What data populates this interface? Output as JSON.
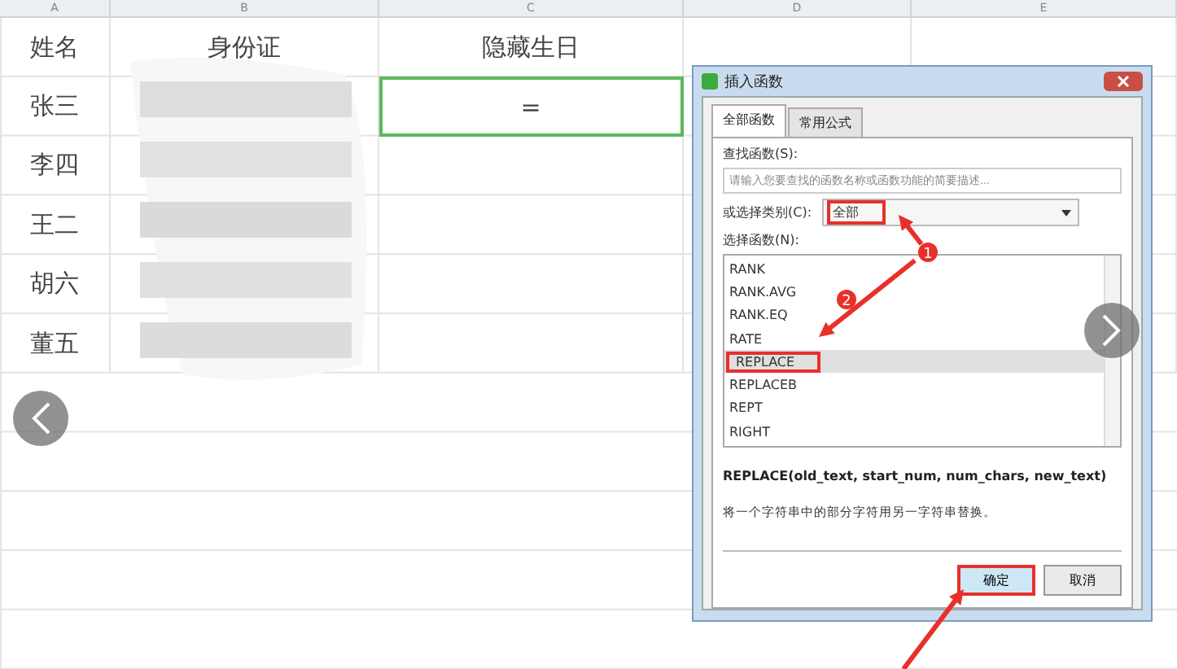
{
  "sheet": {
    "column_letters": [
      "A",
      "B",
      "C",
      "D",
      "E"
    ],
    "header": [
      "姓名",
      "身份证",
      "隐藏生日"
    ],
    "rows": [
      {
        "name": "张三",
        "formula": "=",
        "active": true
      },
      {
        "name": "李四",
        "formula": "",
        "active": false
      },
      {
        "name": "王二",
        "formula": "",
        "active": false
      },
      {
        "name": "胡六",
        "formula": "",
        "active": false
      },
      {
        "name": "董五",
        "formula": "",
        "active": false
      }
    ]
  },
  "dialog": {
    "title": "插入函数",
    "tabs": [
      {
        "label": "全部函数",
        "selected": true
      },
      {
        "label": "常用公式",
        "selected": false
      }
    ],
    "search_label": "查找函数(S):",
    "search_placeholder": "请输入您要查找的函数名称或函数功能的简要描述...",
    "category_label": "或选择类别(C):",
    "category_value": "全部",
    "list_label": "选择函数(N):",
    "functions": [
      {
        "name": "RANK",
        "selected": false
      },
      {
        "name": "RANK.AVG",
        "selected": false
      },
      {
        "name": "RANK.EQ",
        "selected": false
      },
      {
        "name": "RATE",
        "selected": false
      },
      {
        "name": "REPLACE",
        "selected": true
      },
      {
        "name": "REPLACEB",
        "selected": false
      },
      {
        "name": "REPT",
        "selected": false
      },
      {
        "name": "RIGHT",
        "selected": false
      }
    ],
    "signature": "REPLACE(old_text, start_num, num_chars, new_text)",
    "description": "将一个字符串中的部分字符用另一字符串替换。",
    "buttons": [
      "确定",
      "取消"
    ]
  },
  "annotations": [
    "1",
    "2"
  ]
}
